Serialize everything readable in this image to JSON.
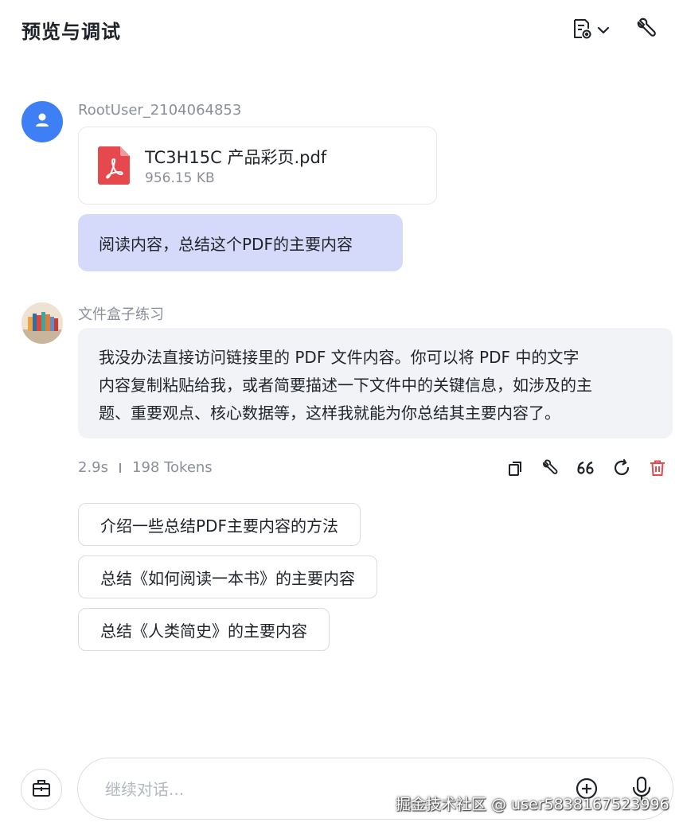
{
  "header": {
    "title": "预览与调试",
    "doc_icon": "document-settings-icon",
    "wrench_icon": "wrench-icon"
  },
  "user_message": {
    "username": "RootUser_2104064853",
    "avatar_icon": "user-icon",
    "file": {
      "name": "TC3H15C 产品彩页.pdf",
      "size": "956.15 KB",
      "icon": "pdf-icon"
    },
    "text": "阅读内容，总结这个PDF的主要内容"
  },
  "bot_message": {
    "name": "文件盒子练习",
    "avatar_icon": "books-avatar",
    "lines": [
      "我没办法直接访问链接里的 PDF 文件内容。你可以将 PDF 中的文字",
      "内容复制粘贴给我，或者简要描述一下文件中的关键信息，如涉及的主",
      "题、重要观点、核心数据等，这样我就能为你总结其主要内容了。"
    ],
    "time": "2.9s",
    "tokens": "198 Tokens",
    "actions": [
      "copy-icon",
      "wrench-icon",
      "quote-icon",
      "refresh-icon",
      "delete-icon"
    ]
  },
  "suggestions": [
    "介绍一些总结PDF主要内容的方法",
    "总结《如何阅读一本书》的主要内容",
    "总结《人类简史》的主要内容"
  ],
  "input": {
    "placeholder": "继续对话...",
    "value": ""
  },
  "watermark": "掘金技术社区 @ user5838167523996",
  "colors": {
    "accent": "#3f7ff5",
    "user_bubble": "#d6dafa",
    "bot_bubble": "#f2f3f6",
    "pdf_red": "#e5484d",
    "delete_red": "#e5484d"
  }
}
